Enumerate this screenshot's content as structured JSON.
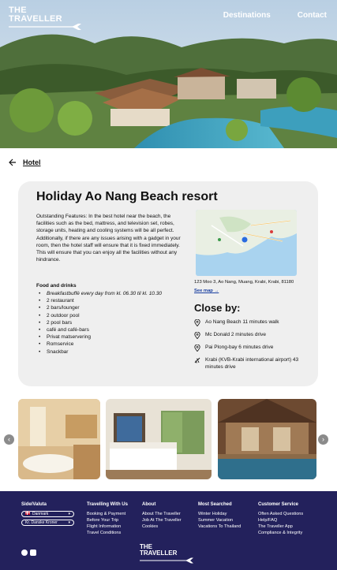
{
  "brand": {
    "line1": "THE",
    "line2": "TRAVELLER"
  },
  "nav": {
    "destinations": "Destinations",
    "contact": "Contact"
  },
  "breadcrumb": {
    "label": "Hotel"
  },
  "hotel": {
    "title": "Holiday Ao Nang Beach resort",
    "description": "Outstanding Features: In the best hotel near the beach, the facilities such as the bed, mattress, and television set, robes, storage units, heating and cooling systems will be all perfect. Additionally, if there are any issues arising with a gadget in your room, then the hotel staff will ensure that it is fixed immediately. This will ensure that you can enjoy all the facilities without any hindrance.",
    "food_title": "Food and drinks",
    "food_items": [
      "Breakfastbuffé every day from kl. 06.30 til kl. 10.30",
      "2 restaurant",
      "2 bars/lounger",
      "2 outdoor pool",
      "2 pool bars",
      "café and café-bars",
      "Privat matservering",
      "Romservice",
      "Snackbar"
    ],
    "address": "123 Moo 3, Ao Nang, Muang, Krabi, Krabi, 81180",
    "see_map": "See map →",
    "close_by_title": "Close by:",
    "close_by": [
      {
        "icon": "location-pin-icon",
        "text": "Ao Nang Beach 11 minutes walk"
      },
      {
        "icon": "location-pin-icon",
        "text": "Mc Donald 2 minutes drive"
      },
      {
        "icon": "location-pin-icon",
        "text": "Pai Plong-bay 6 minutes drive"
      },
      {
        "icon": "airplane-icon",
        "text": "Krabi (KVB-Krabi international airport) 43 minutes drive"
      }
    ]
  },
  "gallery": {
    "prev": "‹",
    "next": "›"
  },
  "footer": {
    "site_title": "Side/Valuta",
    "country": "Danmark",
    "currency": "Kr. Danske Kroner",
    "col1_title": "Travelling With Us",
    "col1": [
      "Booking & Payment",
      "Before Your Trip",
      "Flight Information",
      "Travel Conditions"
    ],
    "col2_title": "About",
    "col2": [
      "About The Traveller",
      "Job At The Traveller",
      "Cookies"
    ],
    "col3_title": "Most Searched",
    "col3": [
      "Winter Holiday",
      "Summer Vacation",
      "Vacations To Thailand"
    ],
    "col4_title": "Customer Service",
    "col4": [
      "Often Asked Questions",
      "Help/FAQ",
      "The Traveller App",
      "Compliance & Integrity"
    ]
  },
  "colors": {
    "footer_bg": "#23215c",
    "card_bg": "#efefef",
    "link": "#1a3fa0"
  }
}
